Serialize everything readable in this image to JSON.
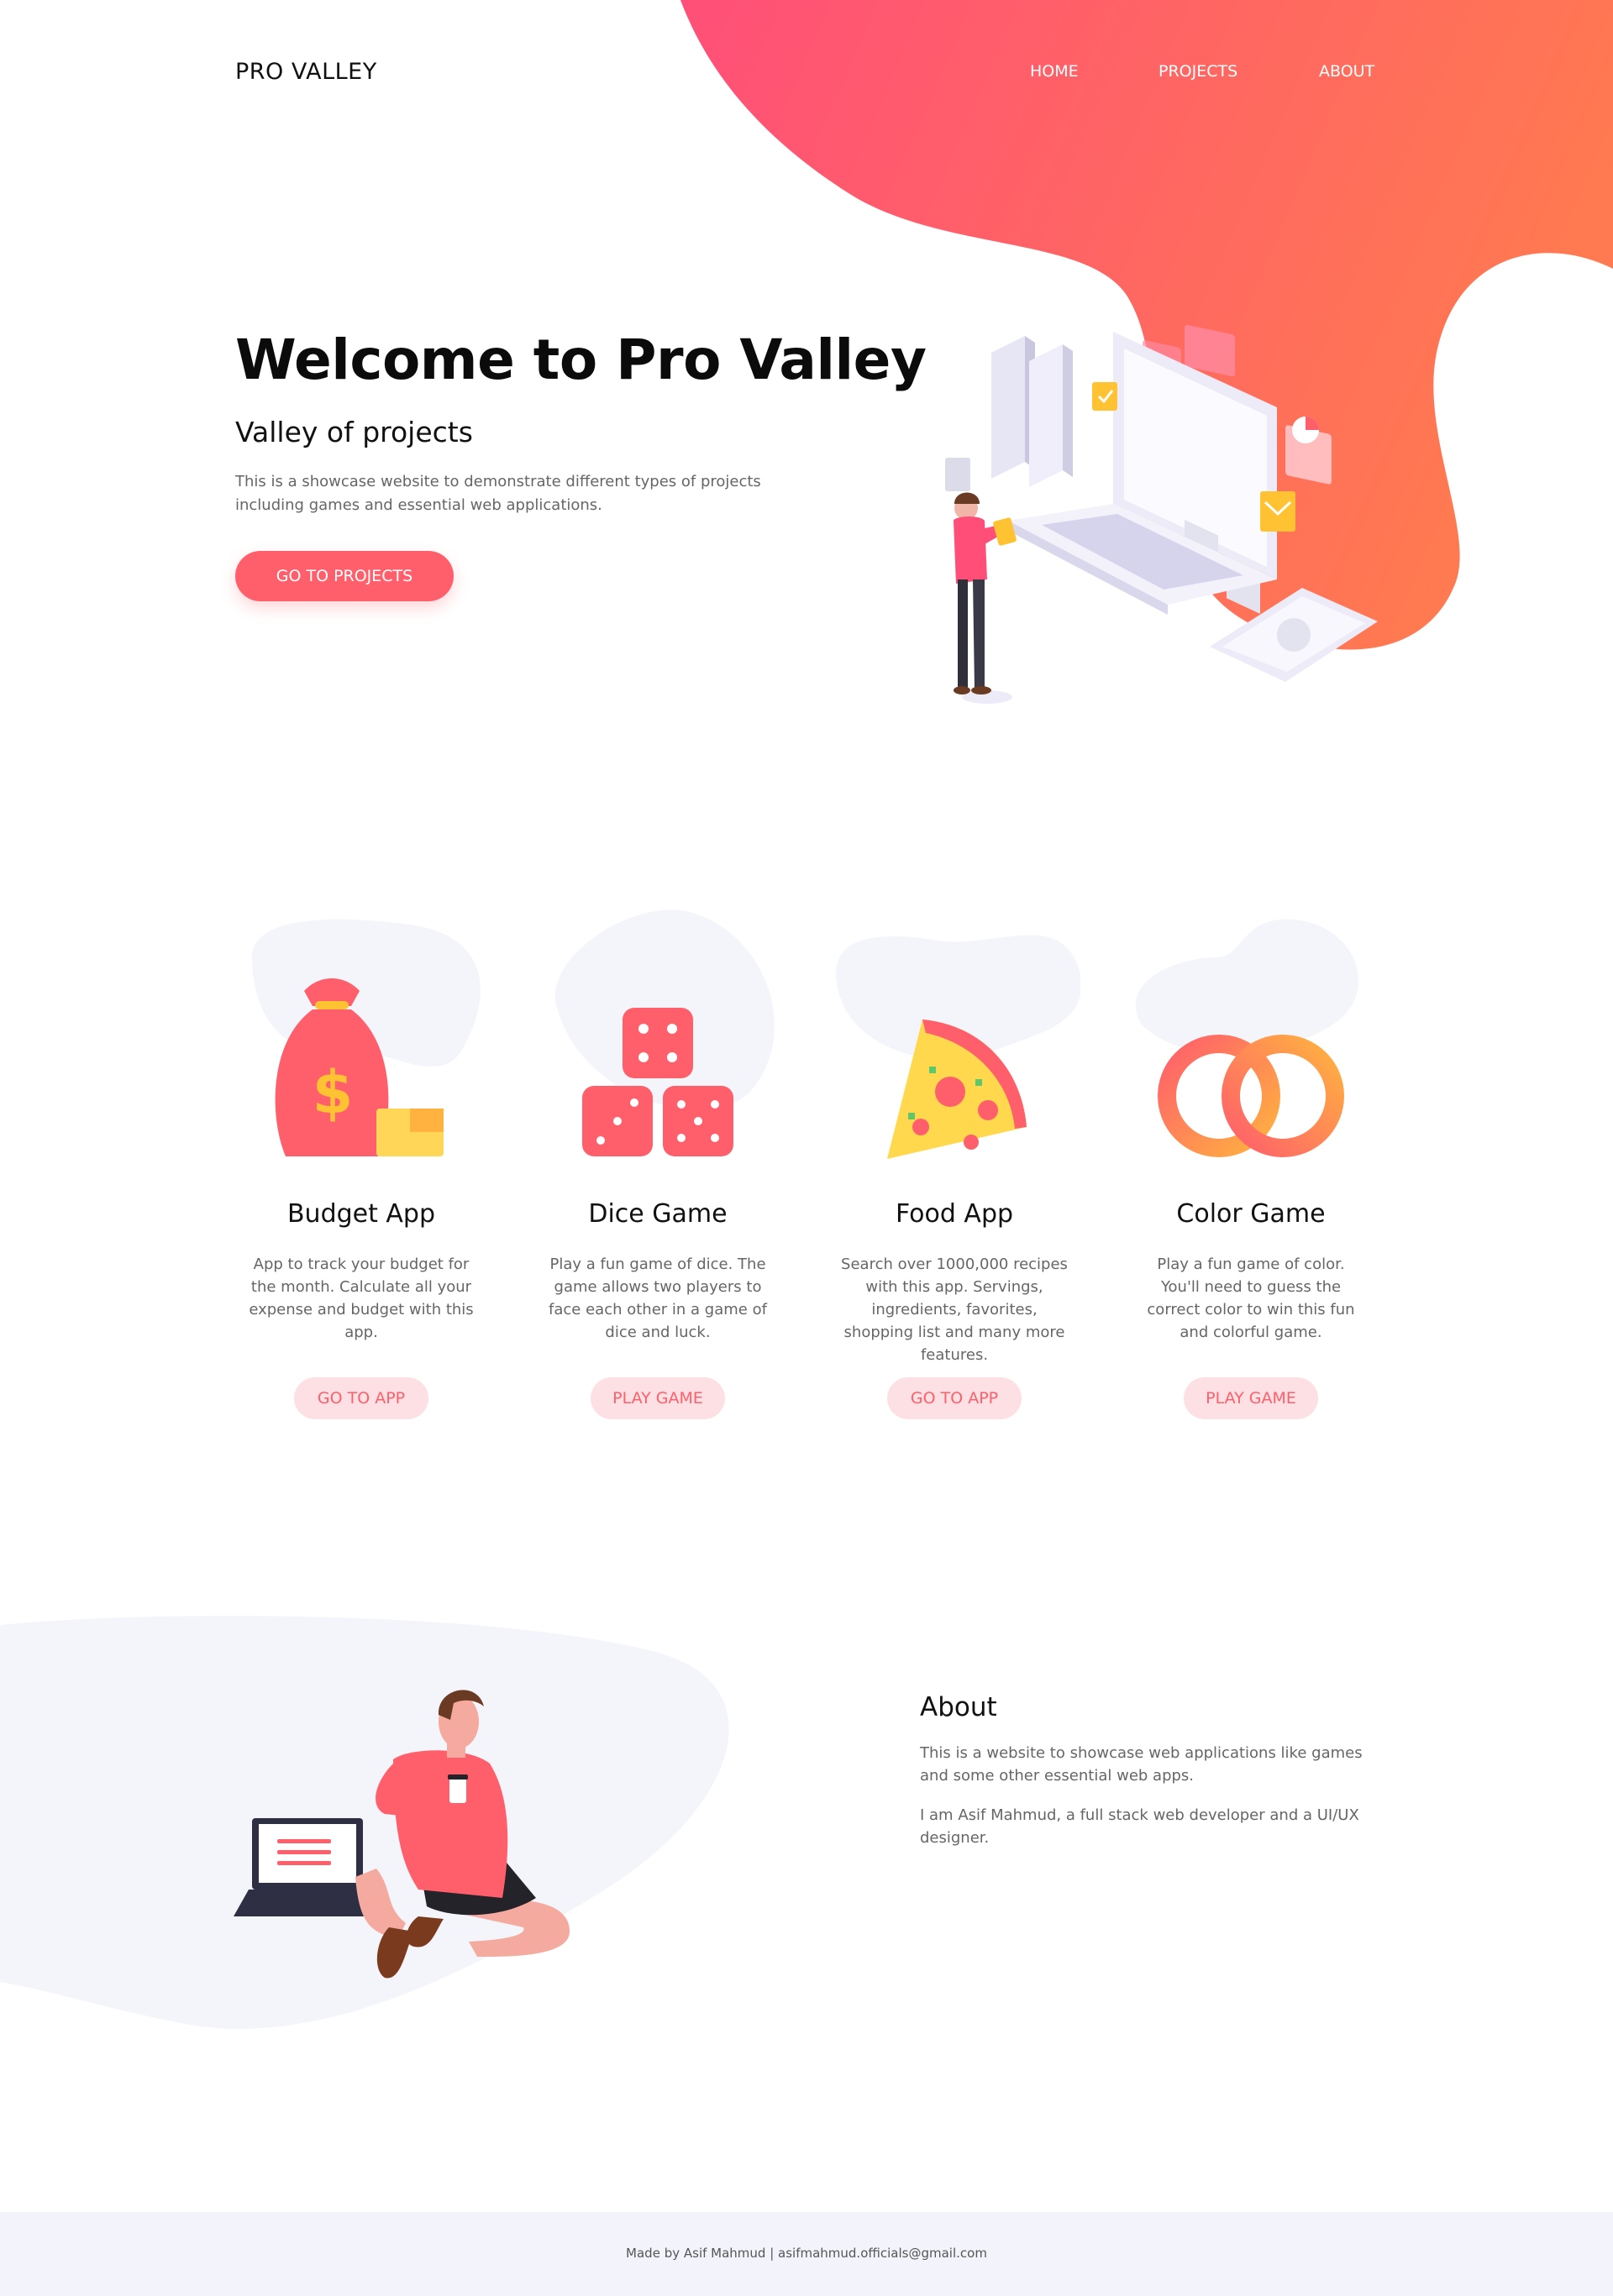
{
  "colors": {
    "accent": "#ff5f6b",
    "accent_light": "#fde0e4",
    "blob_bg": "#f4f4fb",
    "orange": "#ff7a50"
  },
  "header": {
    "logo": "PRO VALLEY",
    "nav": [
      {
        "label": "HOME"
      },
      {
        "label": "PROJECTS"
      },
      {
        "label": "ABOUT"
      }
    ]
  },
  "hero": {
    "title": "Welcome to Pro Valley",
    "subtitle": "Valley of projects",
    "description": "This is a showcase website to demonstrate different types of projects including games and essential web applications.",
    "cta": "GO TO PROJECTS",
    "illustration_icon": "developer-with-laptop-illustration"
  },
  "projects": [
    {
      "title": "Budget App",
      "description": "App to track your budget for the month. Calculate all your expense and budget with this app.",
      "button": "GO TO APP",
      "icon": "money-bag-icon"
    },
    {
      "title": "Dice Game",
      "description": "Play a fun game of dice. The game allows two players to face each other in a game of dice and luck.",
      "button": "PLAY GAME",
      "icon": "dice-icon"
    },
    {
      "title": "Food App",
      "description": "Search over 1000,000 recipes with this app. Servings, ingredients, favorites, shopping list and many more features.",
      "button": "GO TO APP",
      "icon": "pizza-icon"
    },
    {
      "title": "Color Game",
      "description": "Play a fun game of color. You'll need to guess the correct color to win this fun and colorful game.",
      "button": "PLAY GAME",
      "icon": "color-rings-icon"
    }
  ],
  "about": {
    "title": "About",
    "paragraph1": "This is a website to showcase web applications like games and some other essential web apps.",
    "paragraph2": "I am Asif Mahmud, a full stack web developer and a UI/UX designer.",
    "illustration_icon": "person-with-laptop-illustration"
  },
  "footer": {
    "text": "Made by Asif Mahmud | asifmahmud.officials@gmail.com"
  }
}
